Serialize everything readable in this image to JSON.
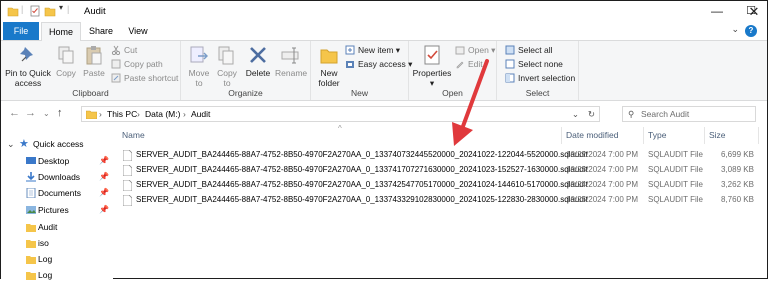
{
  "window": {
    "title": "Audit"
  },
  "tabs": {
    "file": "File",
    "home": "Home",
    "share": "Share",
    "view": "View"
  },
  "clipboard": {
    "pin": "Pin to Quick access",
    "copy": "Copy",
    "paste": "Paste",
    "cut": "Cut",
    "copy_path": "Copy path",
    "paste_shortcut": "Paste shortcut",
    "label": "Clipboard"
  },
  "organize": {
    "move_to": "Move to",
    "copy_to": "Copy to",
    "delete": "Delete",
    "rename": "Rename",
    "label": "Organize"
  },
  "new": {
    "new_folder": "New folder",
    "new_item": "New item",
    "easy_access": "Easy access",
    "label": "New"
  },
  "open": {
    "properties": "Properties",
    "open": "Open",
    "edit": "Edit",
    "label": "Open"
  },
  "select": {
    "select_all": "Select all",
    "select_none": "Select none",
    "invert": "Invert selection",
    "label": "Select"
  },
  "address": {
    "this_pc": "This PC",
    "drive": "Data (M:)",
    "folder": "Audit"
  },
  "search": {
    "placeholder": "Search Audit"
  },
  "nav": {
    "quick_access": "Quick access",
    "items": [
      {
        "label": "Desktop",
        "icon": "desktop-icon",
        "pinned": true
      },
      {
        "label": "Downloads",
        "icon": "downloads-icon",
        "pinned": true
      },
      {
        "label": "Documents",
        "icon": "documents-icon",
        "pinned": true
      },
      {
        "label": "Pictures",
        "icon": "pictures-icon",
        "pinned": true
      },
      {
        "label": "Audit",
        "icon": "folder-icon",
        "pinned": false
      },
      {
        "label": "iso",
        "icon": "folder-icon",
        "pinned": false
      },
      {
        "label": "Log",
        "icon": "folder-icon",
        "pinned": false
      },
      {
        "label": "Log",
        "icon": "folder-icon",
        "pinned": false
      }
    ]
  },
  "columns": {
    "name": "Name",
    "date": "Date modified",
    "type": "Type",
    "size": "Size"
  },
  "files": [
    {
      "name": "SERVER_AUDIT_BA244465-88A7-4752-8B50-4970F2A270AA_0_133740732445520000_20241022-122044-5520000.sqlaudit",
      "date": "10/22/2024 7:00 PM",
      "type": "SQLAUDIT File",
      "size": "6,699 KB"
    },
    {
      "name": "SERVER_AUDIT_BA244465-88A7-4752-8B50-4970F2A270AA_0_133741707271630000_20241023-152527-1630000.sqlaudit",
      "date": "10/23/2024 7:00 PM",
      "type": "SQLAUDIT File",
      "size": "3,089 KB"
    },
    {
      "name": "SERVER_AUDIT_BA244465-88A7-4752-8B50-4970F2A270AA_0_133742547705170000_20241024-144610-5170000.sqlaudit",
      "date": "10/24/2024 7:00 PM",
      "type": "SQLAUDIT File",
      "size": "3,262 KB"
    },
    {
      "name": "SERVER_AUDIT_BA244465-88A7-4752-8B50-4970F2A270AA_0_133743329102830000_20241025-122830-2830000.sqlaudit",
      "date": "10/25/2024 7:00 PM",
      "type": "SQLAUDIT File",
      "size": "8,760 KB"
    }
  ],
  "colors": {
    "accent": "#1979ca",
    "annotation_arrow": "#e0393c",
    "folder": "#f5c54a"
  }
}
